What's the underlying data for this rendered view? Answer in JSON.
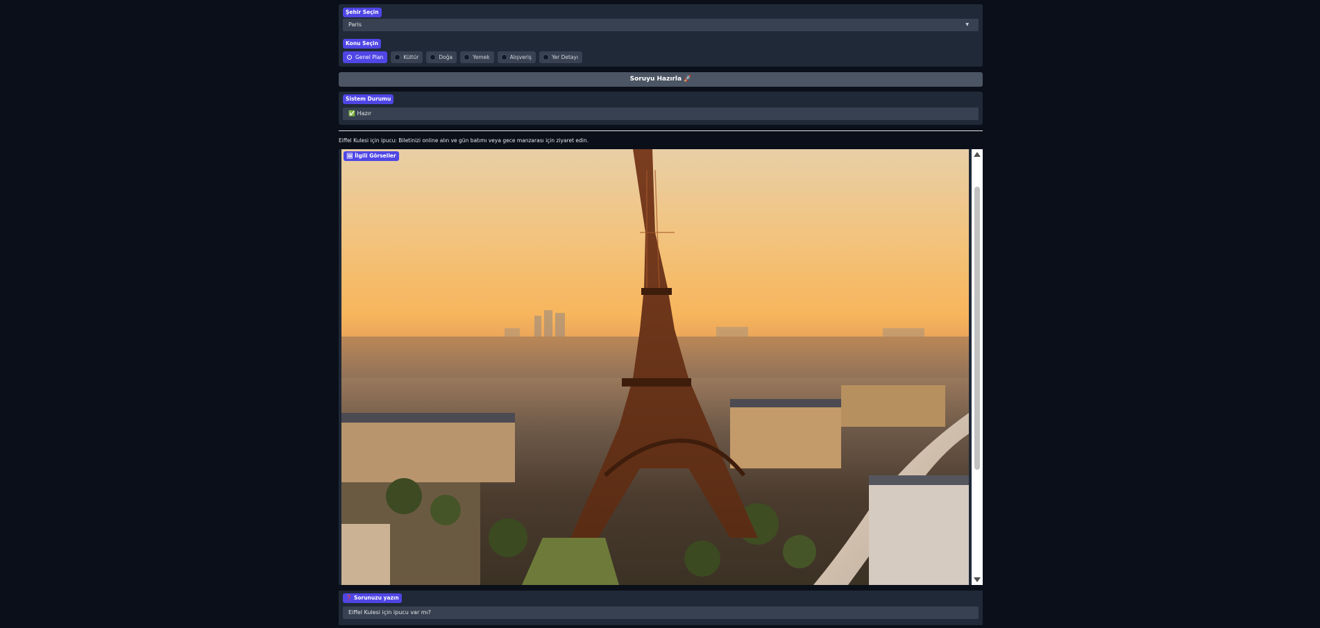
{
  "city": {
    "label": "Şehir Seçin",
    "selected": "Paris"
  },
  "topic": {
    "label": "Konu Seçin",
    "options": [
      "Genel Plan",
      "Kültür",
      "Doğa",
      "Yemek",
      "Alışveriş",
      "Yer Detayı"
    ],
    "selected_index": 0
  },
  "prepare_button": "Soruyu Hazırla 🚀",
  "status": {
    "label": "Sistem Durumu",
    "value": "✅ Hazır"
  },
  "tip_text": "Eiffel Kulesi için ipucu: Biletinizi online alın ve gün batımı veya gece manzarası için ziyaret edin.",
  "gallery": {
    "label": "🖼 İlgili Görseller",
    "image_subject": "Eiffel Tower at sunset over Paris"
  },
  "question": {
    "label": "❓ Sorunuzu yazın",
    "value": "Eiffel Kulesi için ipucu var mı?"
  },
  "colors": {
    "background": "#0b0f19",
    "panel": "#1f2937",
    "field": "#374151",
    "accent": "#4f46e5",
    "button": "#4b5563"
  }
}
